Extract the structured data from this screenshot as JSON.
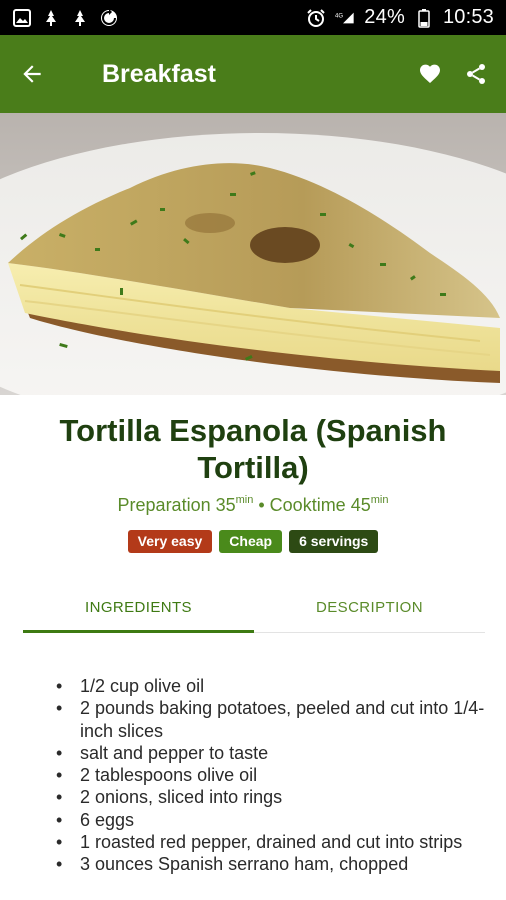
{
  "status_bar": {
    "battery": "24%",
    "time": "10:53",
    "network": "4G"
  },
  "app_bar": {
    "title": "Breakfast"
  },
  "recipe": {
    "title": "Tortilla Espanola (Spanish Tortilla)",
    "prep_label": "Preparation 35",
    "prep_unit": "min",
    "separator": " • ",
    "cook_label": "Cooktime 45",
    "cook_unit": "min",
    "badges": [
      {
        "label": "Very easy",
        "color": "#b33a19"
      },
      {
        "label": "Cheap",
        "color": "#4a8a1b"
      },
      {
        "label": "6 servings",
        "color": "#2d4a14"
      }
    ]
  },
  "tabs": [
    {
      "label": "INGREDIENTS",
      "active": true
    },
    {
      "label": "DESCRIPTION",
      "active": false
    }
  ],
  "ingredients": [
    "1/2 cup olive oil",
    "2 pounds baking potatoes, peeled and cut into 1/4-inch slices",
    "salt and pepper to taste",
    "2 tablespoons olive oil",
    "2 onions, sliced into rings",
    "6 eggs",
    "1 roasted red pepper, drained and cut into strips",
    "3 ounces Spanish serrano ham, chopped"
  ],
  "colors": {
    "app_bar": "#4a7d1a",
    "title_text": "#1f4010",
    "accent": "#5a8b2a"
  },
  "icons": [
    "gallery-icon",
    "notification-icon",
    "notification-icon",
    "sync-icon",
    "alarm-icon",
    "signal-icon",
    "battery-icon",
    "back-arrow-icon",
    "heart-icon",
    "share-icon"
  ]
}
